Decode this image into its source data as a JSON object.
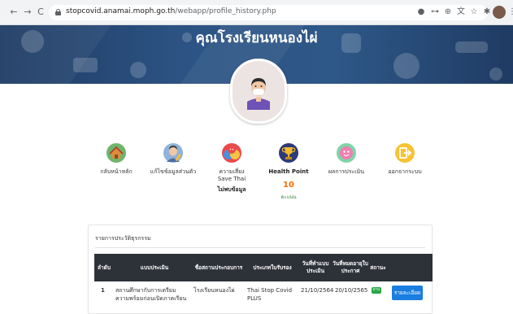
{
  "browser": {
    "url_domain": "stopcovid.anamai.moph.go.th",
    "url_path": "/webapp/profile_history.php"
  },
  "banner": {
    "title": "คุณโรงเรียนหนองไผ่"
  },
  "menu": [
    {
      "label": "กลับหน้าหลัก",
      "icon": "home-icon"
    },
    {
      "label": "แก้ไขข้อมูลส่วนตัว",
      "icon": "edit-profile-icon"
    },
    {
      "label": "ความเสี่ยง",
      "sub": "Save Thai",
      "sub_bold": "ไม่พบข้อมูล",
      "icon": "risk-faces-icon"
    },
    {
      "label": "Health Point",
      "value": "10",
      "unit": "คะแนน",
      "icon": "trophy-icon"
    },
    {
      "label": "ผลการประเมิน",
      "icon": "evaluation-result-icon"
    },
    {
      "label": "ออกจากระบบ",
      "icon": "logout-icon"
    }
  ],
  "history": {
    "title": "รายการประวัติธุรกรรม",
    "columns": [
      "ลำดับ",
      "แบบประเมิน",
      "ชื่อสถานประกอบการ",
      "ประเภทใบรับรอง",
      "วันที่ทำแบบประเมิน",
      "วันที่หมดอายุใบประกาศ",
      "สถานะ"
    ],
    "rows": [
      {
        "no": "1",
        "assessment": "สถานศึกษากับการเตรียมความพร้อมก่อนเปิดภาคเรียน ภาคการ",
        "org": "โรงเรียนหนองไผ่",
        "cert_type": "Thai Stop Covid PLUS",
        "eval_date": "21/10/2564",
        "expire_date": "20/10/2565",
        "status": "ผ่าน",
        "action": "รายละเอียด"
      }
    ]
  },
  "colors": {
    "banner": "#2c5383",
    "table_header": "#2d3138",
    "button": "#1a7de0",
    "status_pass": "#28a745",
    "points": "#ff6a00"
  }
}
